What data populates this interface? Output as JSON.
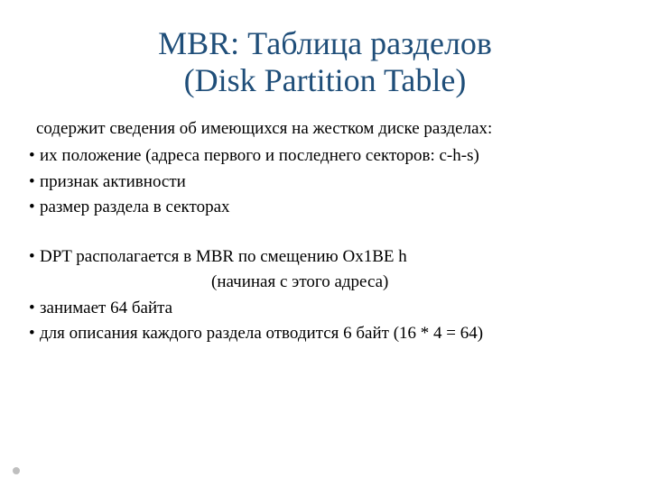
{
  "title_line1": "MBR: Таблица разделов",
  "title_line2": "(Disk Partition Table)",
  "intro": "содержит сведения об имеющихся на жестком диске разделах:",
  "bullets_a": [
    "их положение (адреса первого и последнего секторов: c-h-s)",
    "признак активности",
    "размер раздела в секторах"
  ],
  "bullets_b0_main": "DPT располагается в MBR по смещению Ox1BE h",
  "bullets_b0_sub": "(начиная с этого адреса)",
  "bullets_b_rest": [
    "занимает 64 байта",
    "для описания каждого раздела отводится 6 байт (16 * 4 = 64)"
  ]
}
